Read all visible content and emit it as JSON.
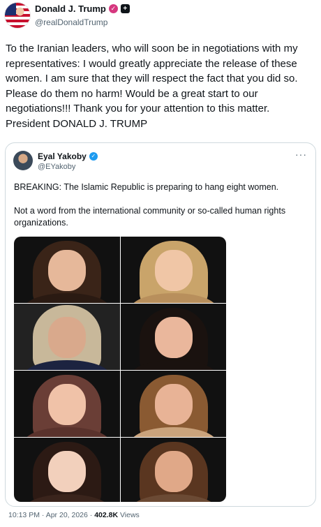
{
  "post": {
    "author_name": "Donald J. Trump",
    "author_handle": "@realDonaldTrump",
    "text": "To the Iranian leaders, who will soon be in negotiations with my representatives: I would greatly appreciate the release of these women. I am sure that they will respect the fact that you did so. Please do them no harm! Would be a great start to our negotiations!!! Thank you for your attention to this matter. President DONALD J. TRUMP"
  },
  "quote": {
    "author_name": "Eyal Yakoby",
    "author_handle": "@EYakoby",
    "text_line1": "BREAKING: The Islamic Republic is preparing to hang eight women.",
    "text_line2": "Not a word from the international community or so-called human rights organizations.",
    "more_label": "···"
  },
  "meta": {
    "time": "10:13 PM",
    "separator": "·",
    "date": "Apr 20, 2026",
    "views_count": "402.8K",
    "views_label": "Views"
  },
  "colors": {
    "text": "#0f1419",
    "secondary": "#536471",
    "verified": "#1d9bf0",
    "border": "#cfd9de"
  }
}
